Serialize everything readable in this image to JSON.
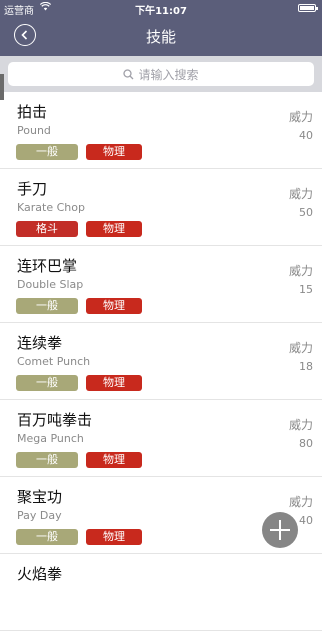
{
  "status": {
    "carrier": "运营商",
    "wifi": "wifi-icon",
    "time": "下午11:07",
    "battery": "battery-icon"
  },
  "nav": {
    "title": "技能",
    "back": "back-icon"
  },
  "search": {
    "placeholder": "请输入搜索"
  },
  "colors": {
    "bar": "#5b5e7a",
    "normal": "#a8a878",
    "fighting": "#c22e28",
    "physical": "#c8291d"
  },
  "power_label": "威力",
  "moves": [
    {
      "name": "拍击",
      "en": "Pound",
      "type": "一般",
      "category": "物理",
      "power": "40"
    },
    {
      "name": "手刀",
      "en": "Karate Chop",
      "type": "格斗",
      "category": "物理",
      "power": "50"
    },
    {
      "name": "连环巴掌",
      "en": "Double Slap",
      "type": "一般",
      "category": "物理",
      "power": "15"
    },
    {
      "name": "连续拳",
      "en": "Comet Punch",
      "type": "一般",
      "category": "物理",
      "power": "18"
    },
    {
      "name": "百万吨拳击",
      "en": "Mega Punch",
      "type": "一般",
      "category": "物理",
      "power": "80"
    },
    {
      "name": "聚宝功",
      "en": "Pay Day",
      "type": "一般",
      "category": "物理",
      "power": "40"
    },
    {
      "name": "火焰拳",
      "en": "",
      "type": "",
      "category": "",
      "power": ""
    }
  ],
  "fab": {
    "icon": "plus-icon"
  }
}
